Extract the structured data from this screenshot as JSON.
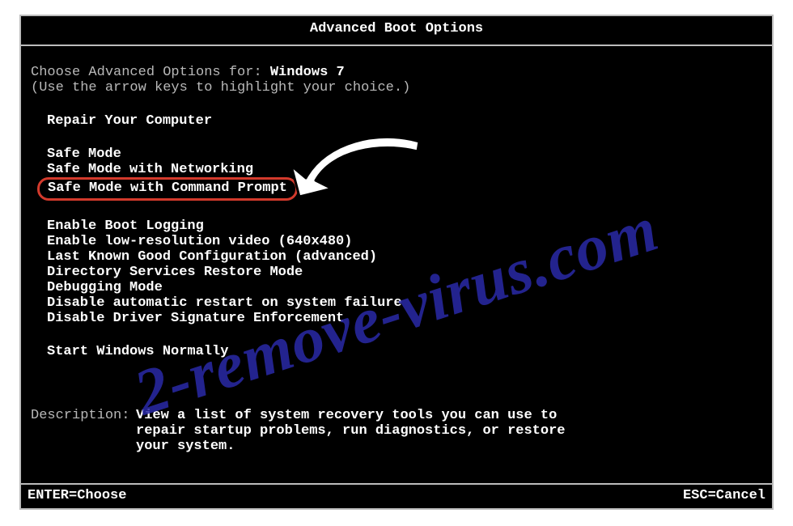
{
  "title": "Advanced Boot Options",
  "choose_label": "Choose Advanced Options for: ",
  "os_name": "Windows 7",
  "instruction": "(Use the arrow keys to highlight your choice.)",
  "options": {
    "group1": [
      "Repair Your Computer"
    ],
    "group2": [
      "Safe Mode",
      "Safe Mode with Networking",
      "Safe Mode with Command Prompt"
    ],
    "group3": [
      "Enable Boot Logging",
      "Enable low-resolution video (640x480)",
      "Last Known Good Configuration (advanced)",
      "Directory Services Restore Mode",
      "Debugging Mode",
      "Disable automatic restart on system failure",
      "Disable Driver Signature Enforcement"
    ],
    "group4": [
      "Start Windows Normally"
    ]
  },
  "highlighted_option": "Safe Mode with Command Prompt",
  "description_label": "Description:",
  "description_text": "View a list of system recovery tools you can use to repair startup problems, run diagnostics, or restore your system.",
  "footer": {
    "left": "ENTER=Choose",
    "right": "ESC=Cancel"
  },
  "watermark": "2-remove-virus.com",
  "annotation": {
    "circle_color": "#d33a2c",
    "arrow_color": "#ffffff"
  }
}
